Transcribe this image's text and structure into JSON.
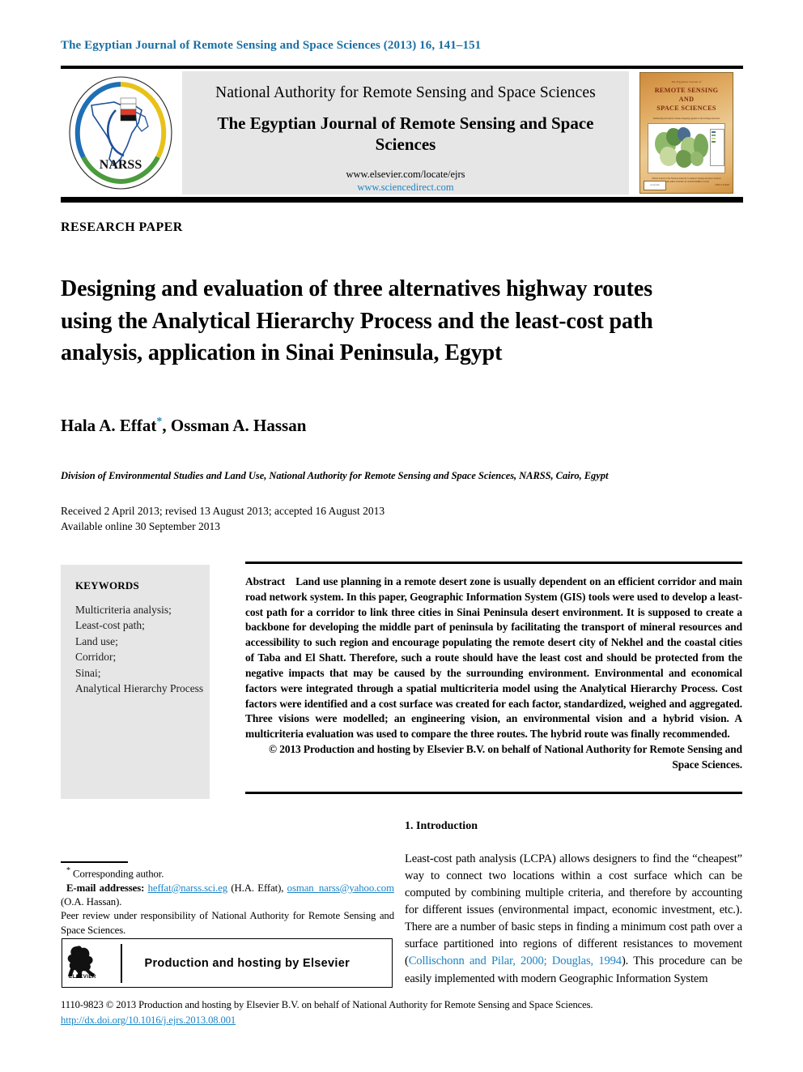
{
  "running_head": "The Egyptian Journal of Remote Sensing and Space Sciences (2013) 16, 141–151",
  "masthead": {
    "publisher": "National Authority for Remote Sensing and Space Sciences",
    "journal_title": "The Egyptian Journal of Remote Sensing and Space Sciences",
    "url_elsevier": "www.elsevier.com/locate/ejrs",
    "url_sciencedirect": "www.sciencedirect.com",
    "logo_text": "NARSS",
    "cover": {
      "top_line": "The Egyptian Journal of",
      "title_line1": "REMOTE SENSING",
      "title_line2": "AND",
      "title_line3": "SPACE SCIENCES",
      "caption": "Monitoring and surface feature mapping applied to land change detection",
      "footer_line1": "Official Journal of the National Authority for Remote Sensing and Space Sciences",
      "footer_line2": "AVAILABLE ONLINE AT SCIENCEDIRECT.COM",
      "issn_text": "ISSN 1110-9823",
      "publisher_badge": "ELSEVIER"
    }
  },
  "article": {
    "type": "RESEARCH PAPER",
    "title": "Designing and evaluation of three alternatives highway routes using the Analytical Hierarchy Process and the least-cost path analysis, application in Sinai Peninsula, Egypt",
    "authors": "Hala A. Effat",
    "authors_rest": ", Ossman A. Hassan",
    "corresponding_marker": "*",
    "affiliation": "Division of Environmental Studies and Land Use, National Authority for Remote Sensing and Space Sciences, NARSS, Cairo, Egypt",
    "history_line1": "Received 2 April 2013; revised 13 August 2013; accepted 16 August 2013",
    "history_line2": "Available online 30 September 2013"
  },
  "keywords": {
    "heading": "KEYWORDS",
    "items": [
      "Multicriteria analysis;",
      "Least-cost path;",
      "Land use;",
      "Corridor;",
      "Sinai;",
      "Analytical Hierarchy Process"
    ]
  },
  "abstract": {
    "label": "Abstract",
    "text": "Land use planning in a remote desert zone is usually dependent on an efficient corridor and main road network system. In this paper, Geographic Information System (GIS) tools were used to develop a least-cost path for a corridor to link three cities in Sinai Peninsula desert environment. It is supposed to create a backbone for developing the middle part of peninsula by facilitating the transport of mineral resources and accessibility to such region and encourage populating the remote desert city of Nekhel and the coastal cities of Taba and El Shatt. Therefore, such a route should have the least cost and should be protected from the negative impacts that may be caused by the surrounding environment. Environmental and economical factors were integrated through a spatial multicriteria model using the Analytical Hierarchy Process. Cost factors were identified and a cost surface was created for each factor, standardized, weighed and aggregated. Three visions were modelled; an engineering vision, an environmental vision and a hybrid vision. A multicriteria evaluation was used to compare the three routes. The hybrid route was finally recommended.",
    "copyright": "© 2013 Production and hosting by Elsevier B.V. on behalf of National Authority for Remote Sensing and Space Sciences."
  },
  "introduction": {
    "heading": "1. Introduction",
    "para_part1": "Least-cost path analysis (LCPA) allows designers to find the “cheapest” way to connect two locations within a cost surface which can be computed by combining multiple criteria, and therefore by accounting for different issues (environmental impact, economic investment, etc.). There are a number of basic steps in finding a minimum cost path over a surface partitioned into regions of different resistances to movement (",
    "citation": "Collischonn and Pilar, 2000; Douglas, 1994",
    "para_part2": "). This procedure can be easily implemented with modern Geographic Information System"
  },
  "footnotes": {
    "corresponding": "Corresponding author.",
    "email_label": "E-mail addresses:",
    "email1": "heffat@narss.sci.eg",
    "email1_owner": "(H.A. Effat),",
    "email2": "osman_narss@yahoo.com",
    "email2_owner": "(O.A. Hassan).",
    "peer_review": "Peer review under responsibility of National Authority for Remote Sensing and Space Sciences."
  },
  "elsevier_box": {
    "label": "Production and hosting by Elsevier",
    "wordmark": "ELSEVIER"
  },
  "bottom": {
    "copyright": "1110-9823 © 2013 Production and hosting by Elsevier B.V. on behalf of National Authority for Remote Sensing and Space Sciences.",
    "doi": "http://dx.doi.org/10.1016/j.ejrs.2013.08.001"
  },
  "colors": {
    "link": "#1a84c7",
    "running_head": "#1a6fa3",
    "panel_gray": "#e6e6e6"
  }
}
